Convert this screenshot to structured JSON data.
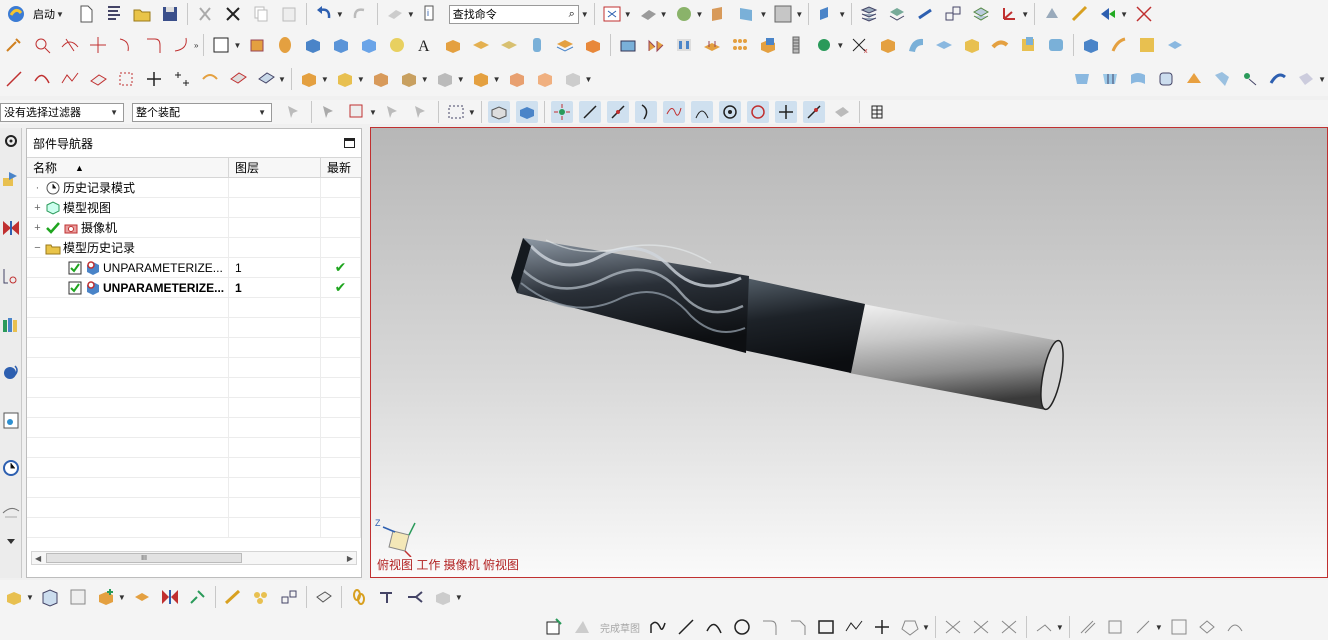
{
  "toolbar": {
    "start_label": "启动",
    "command_search_placeholder": "查找命令"
  },
  "selection_bar": {
    "filter_value": "没有选择过滤器",
    "scope_value": "整个装配"
  },
  "navigator": {
    "title": "部件导航器",
    "columns": {
      "name": "名称",
      "layer": "图层",
      "latest": "最新"
    },
    "rows": [
      {
        "label": "历史记录模式",
        "layer": "",
        "latest": ""
      },
      {
        "label": "模型视图",
        "layer": "",
        "latest": ""
      },
      {
        "label": "摄像机",
        "layer": "",
        "latest": ""
      },
      {
        "label": "模型历史记录",
        "layer": "",
        "latest": ""
      },
      {
        "label": "UNPARAMETERIZE...",
        "layer": "1",
        "latest": "✔"
      },
      {
        "label": "UNPARAMETERIZE...",
        "layer": "1",
        "latest": "✔"
      }
    ],
    "scroll_thumb": "III"
  },
  "viewport": {
    "view_label": "俯视图 工作 摄像机 俯视图",
    "triad_axis": "Z"
  },
  "sketch_bar": {
    "finish_label": "完成草图"
  },
  "colors": {
    "accent_red": "#c03030",
    "check_green": "#1fa51f",
    "viewport_top": "#b7b7b7",
    "viewport_bottom": "#fafafa"
  }
}
